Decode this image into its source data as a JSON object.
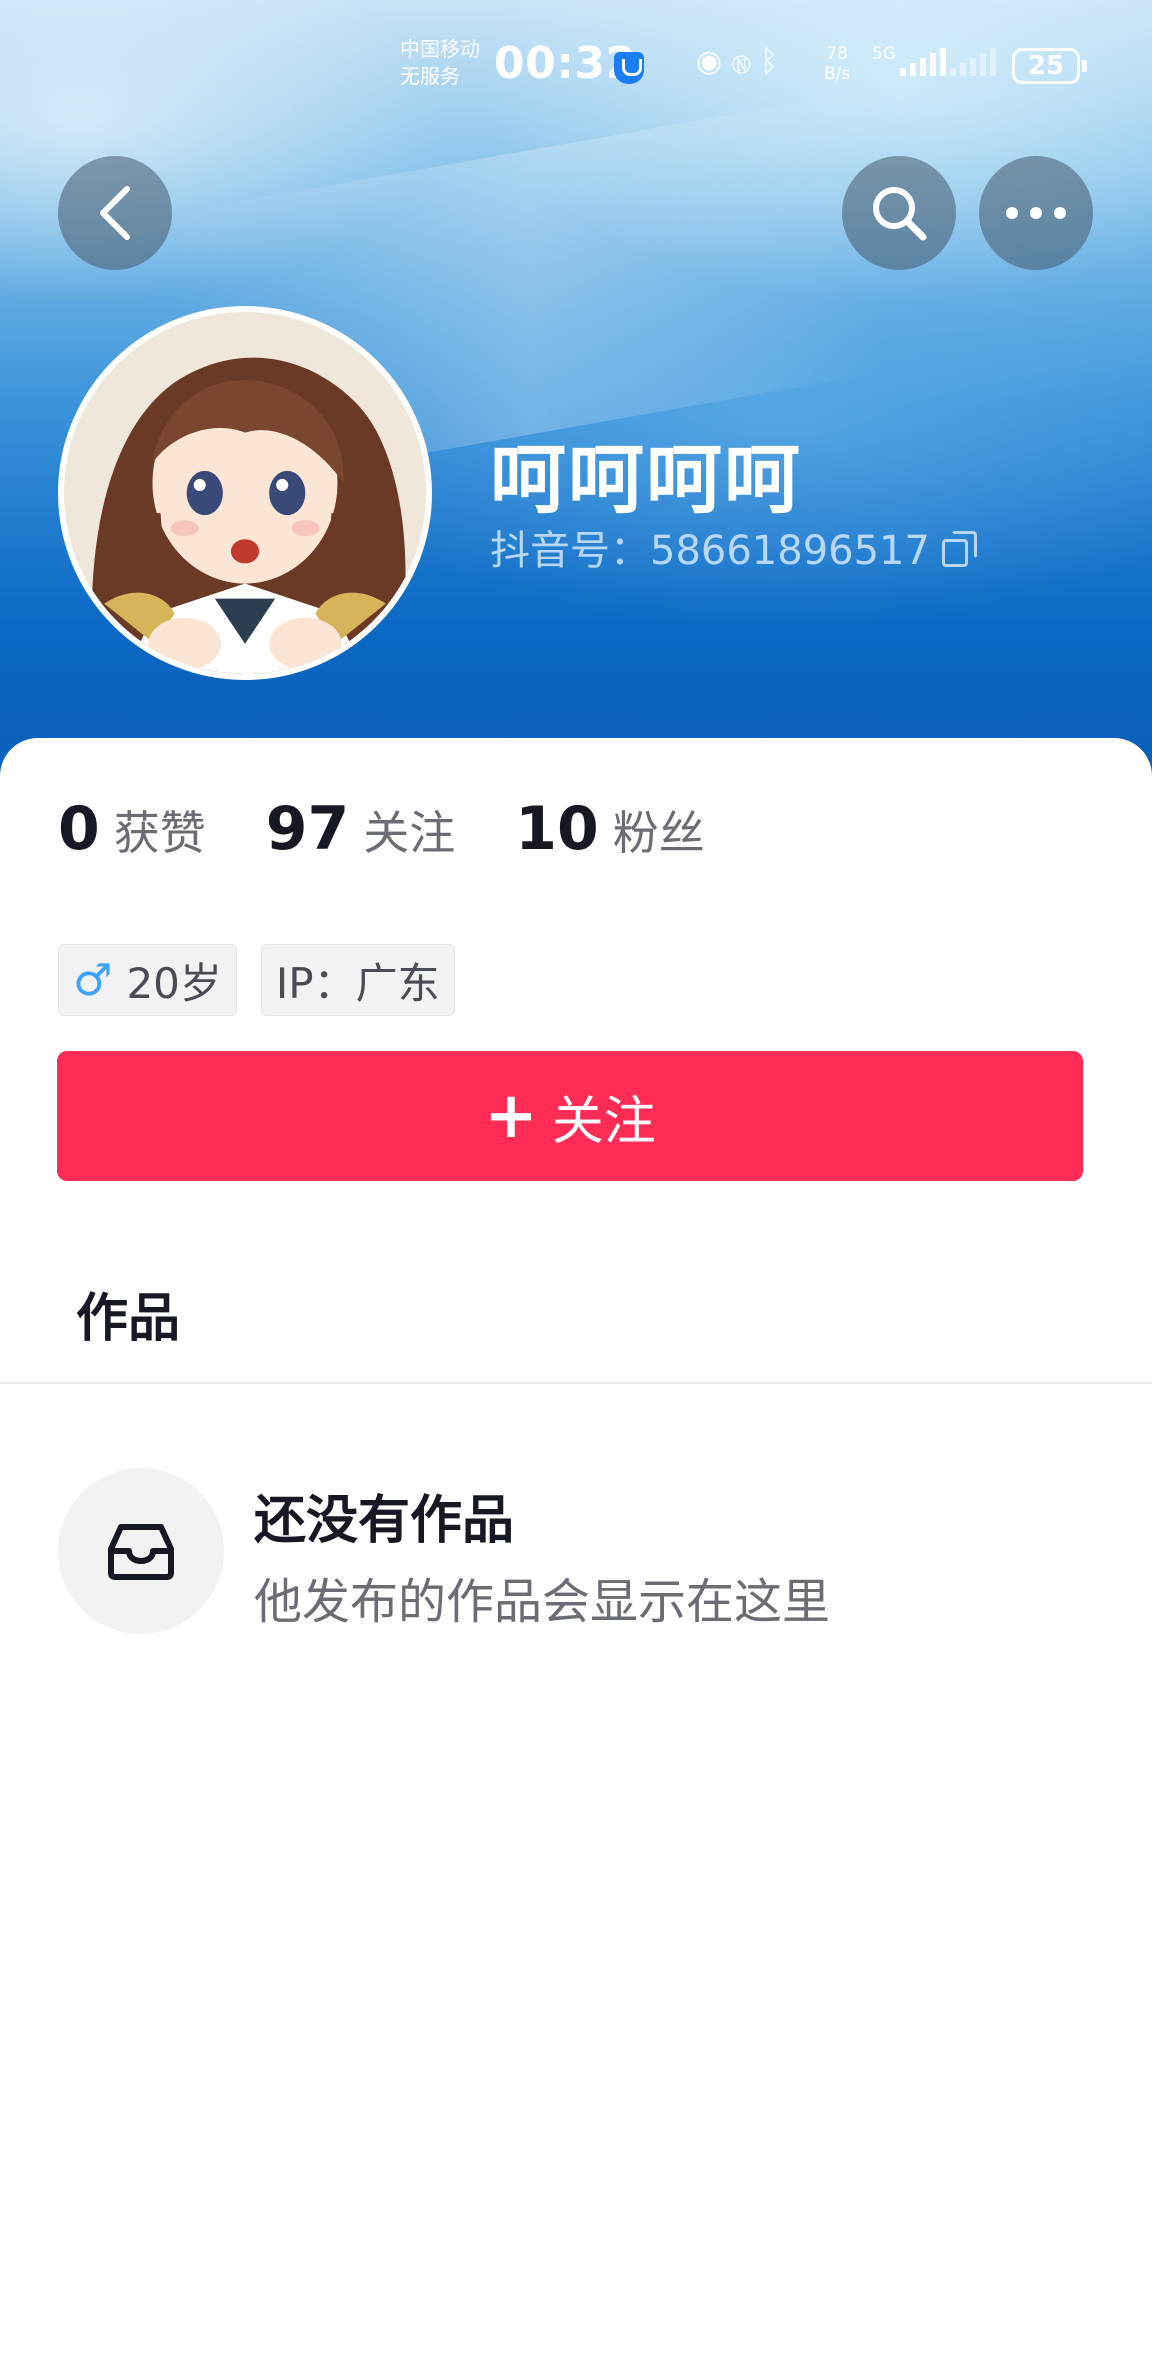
{
  "status_bar": {
    "carrier_line1": "中国移动",
    "carrier_line2": "无服务",
    "time": "00:32",
    "net_speed_value": "78",
    "net_speed_unit": "B/s",
    "network": "5G",
    "battery": "25"
  },
  "header": {
    "back_icon": "chevron-left-icon",
    "search_icon": "search-icon",
    "more_icon": "more-horizontal-icon"
  },
  "profile": {
    "name": "呵呵呵呵",
    "douyin_id_label": "抖音号：",
    "douyin_id": "58661896517"
  },
  "stats": {
    "likes": {
      "value": "0",
      "label": "获赞"
    },
    "following": {
      "value": "97",
      "label": "关注"
    },
    "followers": {
      "value": "10",
      "label": "粉丝"
    }
  },
  "tags": {
    "gender_symbol": "♂",
    "age": "20岁",
    "ip": "IP：广东"
  },
  "follow_button": {
    "plus": "+",
    "label": "关注"
  },
  "tabs": {
    "works": "作品"
  },
  "empty_state": {
    "icon": "inbox-icon",
    "title": "还没有作品",
    "subtitle": "他发布的作品会显示在这里"
  },
  "colors": {
    "accent": "#fe2c55",
    "text_primary": "#161823",
    "text_secondary": "#6b6d75",
    "male": "#3da1ff"
  }
}
